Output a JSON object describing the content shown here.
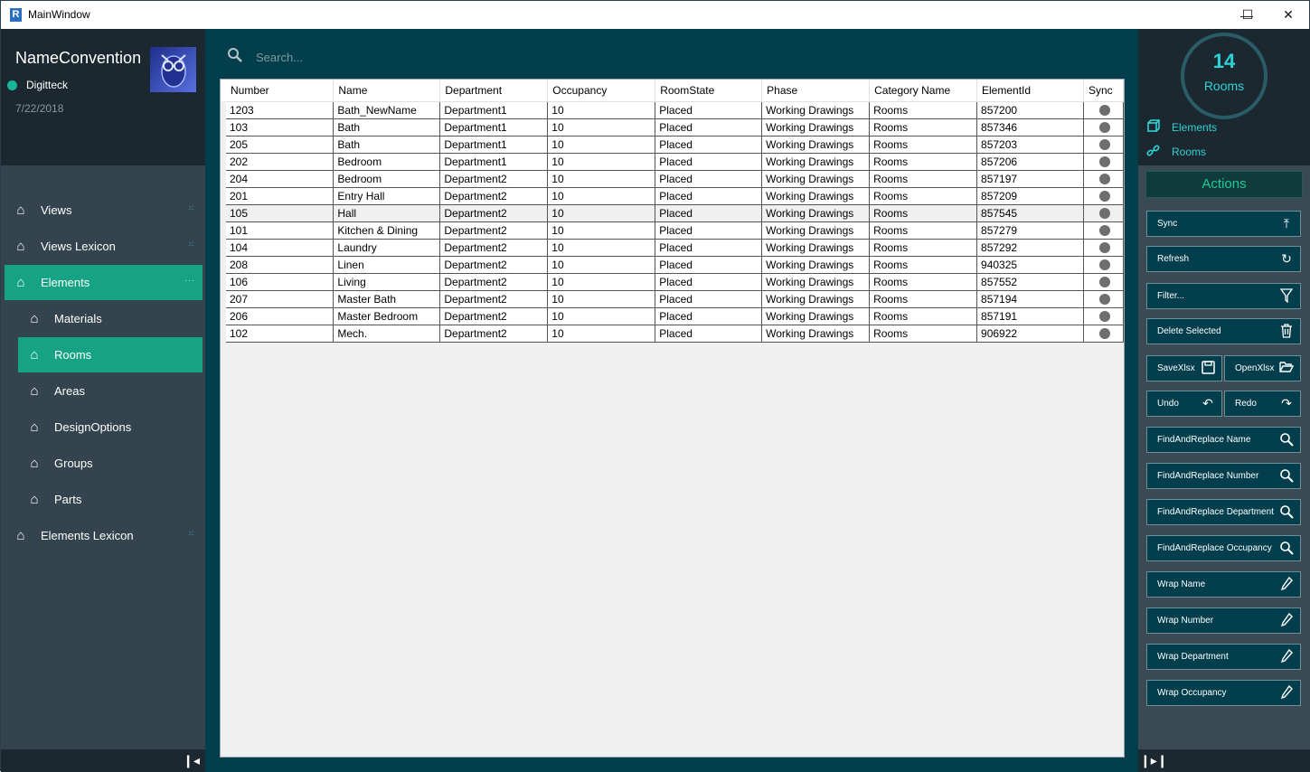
{
  "window": {
    "title": "MainWindow",
    "minimize": "—",
    "maximize": "☐",
    "close": "✕"
  },
  "profile": {
    "app_name": "NameConvention",
    "user": "Digitteck",
    "date": "7/22/2018"
  },
  "sidebar": {
    "items": [
      {
        "label": "Views"
      },
      {
        "label": "Views Lexicon"
      },
      {
        "label": "Elements"
      },
      {
        "label": "Materials"
      },
      {
        "label": "Rooms"
      },
      {
        "label": "Areas"
      },
      {
        "label": "DesignOptions"
      },
      {
        "label": "Groups"
      },
      {
        "label": "Parts"
      },
      {
        "label": "Elements Lexicon"
      }
    ]
  },
  "search": {
    "placeholder": "Search..."
  },
  "table": {
    "columns": [
      "Number",
      "Name",
      "Department",
      "Occupancy",
      "RoomState",
      "Phase",
      "Category Name",
      "ElementId",
      "Sync"
    ],
    "rows": [
      [
        "1203",
        "Bath_NewName",
        "Department1",
        "10",
        "Placed",
        "Working Drawings",
        "Rooms",
        "857200"
      ],
      [
        "103",
        "Bath",
        "Department1",
        "10",
        "Placed",
        "Working Drawings",
        "Rooms",
        "857346"
      ],
      [
        "205",
        "Bath",
        "Department1",
        "10",
        "Placed",
        "Working Drawings",
        "Rooms",
        "857203"
      ],
      [
        "202",
        "Bedroom",
        "Department1",
        "10",
        "Placed",
        "Working Drawings",
        "Rooms",
        "857206"
      ],
      [
        "204",
        "Bedroom",
        "Department2",
        "10",
        "Placed",
        "Working Drawings",
        "Rooms",
        "857197"
      ],
      [
        "201",
        "Entry Hall",
        "Department2",
        "10",
        "Placed",
        "Working Drawings",
        "Rooms",
        "857209"
      ],
      [
        "105",
        "Hall",
        "Department2",
        "10",
        "Placed",
        "Working Drawings",
        "Rooms",
        "857545"
      ],
      [
        "101",
        "Kitchen & Dining",
        "Department2",
        "10",
        "Placed",
        "Working Drawings",
        "Rooms",
        "857279"
      ],
      [
        "104",
        "Laundry",
        "Department2",
        "10",
        "Placed",
        "Working Drawings",
        "Rooms",
        "857292"
      ],
      [
        "208",
        "Linen",
        "Department2",
        "10",
        "Placed",
        "Working Drawings",
        "Rooms",
        "940325"
      ],
      [
        "106",
        "Living",
        "Department2",
        "10",
        "Placed",
        "Working Drawings",
        "Rooms",
        "857552"
      ],
      [
        "207",
        "Master Bath",
        "Department2",
        "10",
        "Placed",
        "Working Drawings",
        "Rooms",
        "857194"
      ],
      [
        "206",
        "Master Bedroom",
        "Department2",
        "10",
        "Placed",
        "Working Drawings",
        "Rooms",
        "857191"
      ],
      [
        "102",
        "Mech.",
        "Department2",
        "10",
        "Placed",
        "Working Drawings",
        "Rooms",
        "906922"
      ]
    ]
  },
  "summary": {
    "count": "14",
    "label": "Rooms",
    "link_elements": "Elements",
    "link_rooms": "Rooms"
  },
  "actions": {
    "header": "Actions",
    "sync": "Sync",
    "refresh": "Refresh",
    "filter": "Filter...",
    "delete_selected": "Delete Selected",
    "save_xlsx": "SaveXlsx",
    "open_xlsx": "OpenXlsx",
    "undo": "Undo",
    "redo": "Redo",
    "far_name": "FindAndReplace Name",
    "far_number": "FindAndReplace Number",
    "far_department": "FindAndReplace Department",
    "far_occupancy": "FindAndReplace Occupancy",
    "wrap_name": "Wrap Name",
    "wrap_number": "Wrap Number",
    "wrap_department": "Wrap Department",
    "wrap_occupancy": "Wrap Occupancy"
  }
}
